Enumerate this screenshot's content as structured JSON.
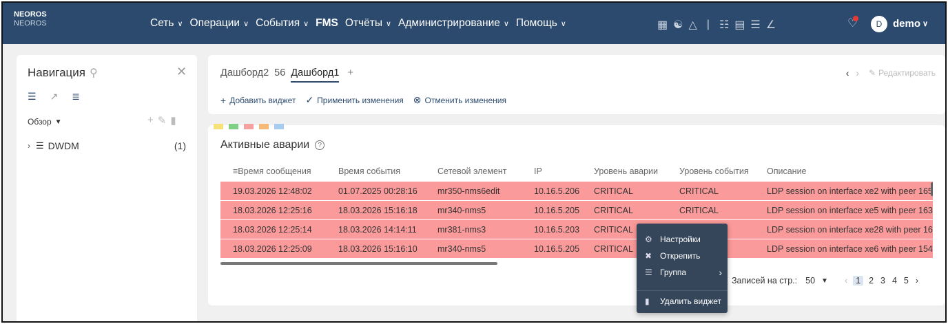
{
  "header": {
    "logo_line1": "NEOROS",
    "logo_line2": "NEOROS",
    "menu": [
      {
        "label": "Сеть"
      },
      {
        "label": "Операции"
      },
      {
        "label": "События"
      },
      {
        "label": "FMS"
      },
      {
        "label": "Отчёты"
      },
      {
        "label": "Администрирование"
      },
      {
        "label": "Помощь"
      }
    ],
    "avatar_letter": "D",
    "username": "demo"
  },
  "navigation": {
    "title": "Навигация",
    "section": "Обзор",
    "tree": [
      {
        "label": "DWDM",
        "count": "(1)"
      }
    ]
  },
  "dashboard": {
    "tabs": [
      {
        "label": "Дашборд2"
      },
      {
        "label": "56"
      },
      {
        "label": "Дашборд1",
        "active": true
      }
    ],
    "add_tab": "+",
    "edit_label": "Редактировать",
    "add_widget": "Добавить виджет",
    "apply_changes": "Применить изменения",
    "cancel_changes": "Отменить изменения"
  },
  "widget": {
    "title": "Активные аварии",
    "columns": [
      "Время сообщения",
      "Время события",
      "Сетевой элемент",
      "IP",
      "Уровень аварии",
      "Уровень события",
      "Описание"
    ],
    "rows": [
      [
        "19.03.2026 12:48:02",
        "01.07.2025 00:28:16",
        "mr350-nms6edit",
        "10.16.5.206",
        "CRITICAL",
        "CRITICAL",
        "LDP session on interface xe2 with peer 165"
      ],
      [
        "18.03.2026 12:25:16",
        "18.03.2026 15:16:18",
        "mr340-nms5",
        "10.16.5.205",
        "CRITICAL",
        "CRITICAL",
        "LDP session on interface xe5 with peer 163"
      ],
      [
        "18.03.2026 12:25:14",
        "18.03.2026 14:14:11",
        "mr381-nms3",
        "10.16.5.203",
        "CRITICAL",
        "",
        "LDP session on interface xe28 with peer 16"
      ],
      [
        "18.03.2026 12:25:09",
        "18.03.2026 15:16:10",
        "mr340-nms5",
        "10.16.5.205",
        "CRITICAL",
        "",
        "LDP session on interface xe6 with peer 154"
      ]
    ],
    "rows_per_page_label": "Записей на стр.:",
    "rows_per_page": "50",
    "pages": [
      "1",
      "2",
      "3",
      "4",
      "5"
    ],
    "current_page": "1",
    "row_color": "#fb9a9a"
  },
  "context_menu": {
    "items": [
      {
        "label": "Настройки",
        "icon": "gear-icon"
      },
      {
        "label": "Открепить",
        "icon": "unpin-icon"
      },
      {
        "label": "Группа",
        "icon": "layers-icon"
      },
      {
        "label": "Удалить виджет",
        "icon": "trash-icon"
      }
    ]
  },
  "colors": {
    "topbar": "#2c4a6e",
    "critical_row": "#fb9a9a",
    "context_menu": "#35465a"
  }
}
